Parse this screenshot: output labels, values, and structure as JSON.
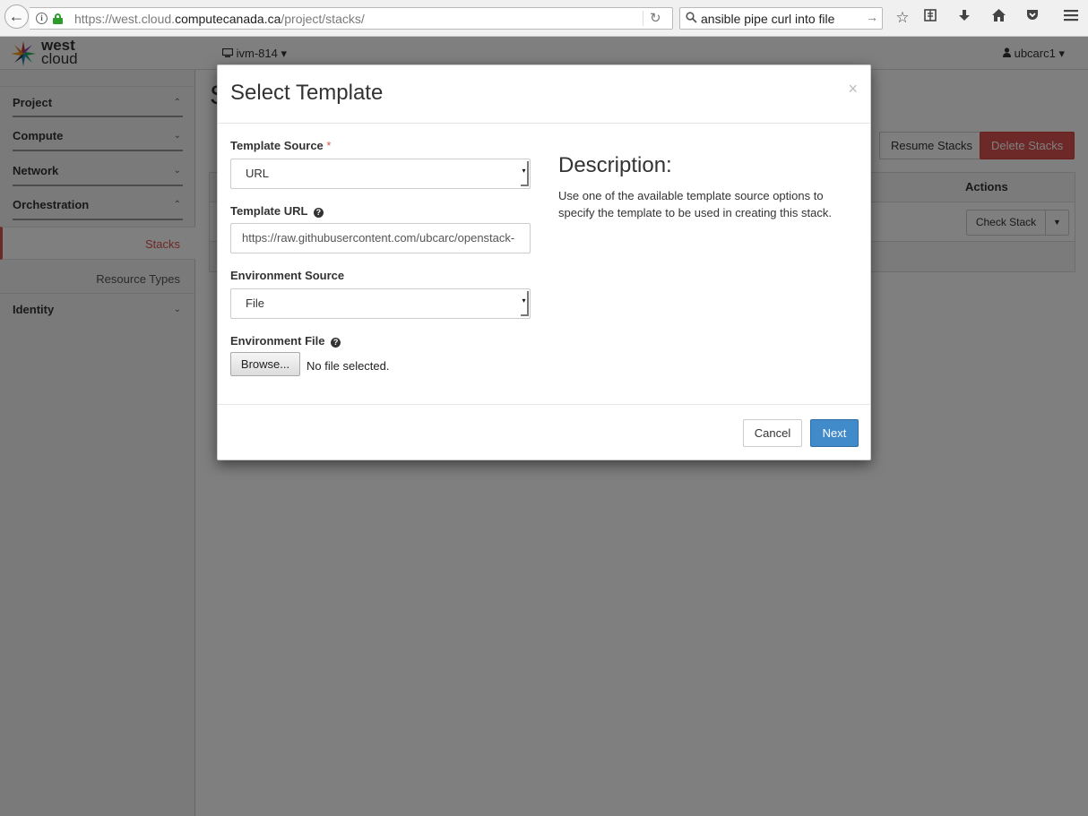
{
  "browser": {
    "url_prefix": "https://west.cloud.",
    "url_host": "computecanada.ca",
    "url_path": "/project/stacks/",
    "search_query": "ansible pipe curl into file"
  },
  "header": {
    "logo_line1": "west",
    "logo_line2": "cloud",
    "project": "ivm-814",
    "user": "ubcarc1"
  },
  "sidebar": {
    "project": "Project",
    "compute": "Compute",
    "network": "Network",
    "orchestration": "Orchestration",
    "stacks": "Stacks",
    "resource_types": "Resource Types",
    "identity": "Identity"
  },
  "page": {
    "title_fragment": "S",
    "resume_label": "Resume Stacks",
    "delete_label": "Delete Stacks",
    "actions_header": "Actions",
    "check_stack_label": "Check Stack"
  },
  "modal": {
    "title": "Select Template",
    "close": "×",
    "template_source_label": "Template Source",
    "required_mark": "*",
    "template_source_value": "URL",
    "template_url_label": "Template URL",
    "template_url_value": "https://raw.githubusercontent.com/ubcarc/openstack-",
    "env_source_label": "Environment Source",
    "env_source_value": "File",
    "env_file_label": "Environment File",
    "browse_label": "Browse...",
    "no_file_text": "No file selected.",
    "desc_title": "Description:",
    "desc_text": "Use one of the available template source options to specify the template to be used in creating this stack.",
    "cancel_label": "Cancel",
    "next_label": "Next"
  },
  "colors": {
    "accent_red": "#d9534f",
    "primary_blue": "#428bca",
    "secure_green": "#2d9c2d"
  }
}
